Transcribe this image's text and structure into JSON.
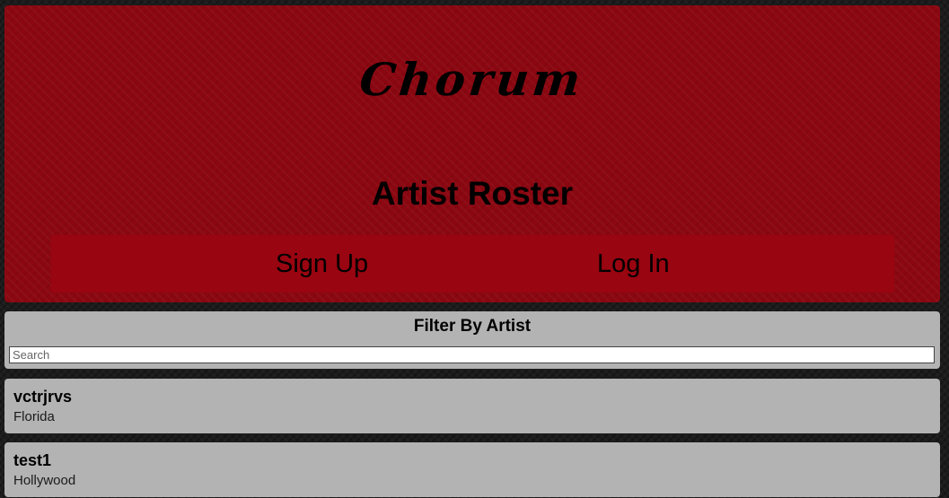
{
  "header": {
    "logo_text": "Chorum",
    "page_title": "Artist Roster",
    "signup_label": "Sign Up",
    "login_label": "Log In"
  },
  "filter": {
    "title": "Filter By Artist",
    "placeholder": "Search",
    "value": ""
  },
  "artists": [
    {
      "name": "vctrjrvs",
      "location": "Florida"
    },
    {
      "name": "test1",
      "location": "Hollywood"
    }
  ],
  "colors": {
    "header_bg": "#8b0711",
    "auth_bar_bg": "#990510",
    "card_bg": "#b3b3b3",
    "page_bg": "#1c1c1c"
  }
}
